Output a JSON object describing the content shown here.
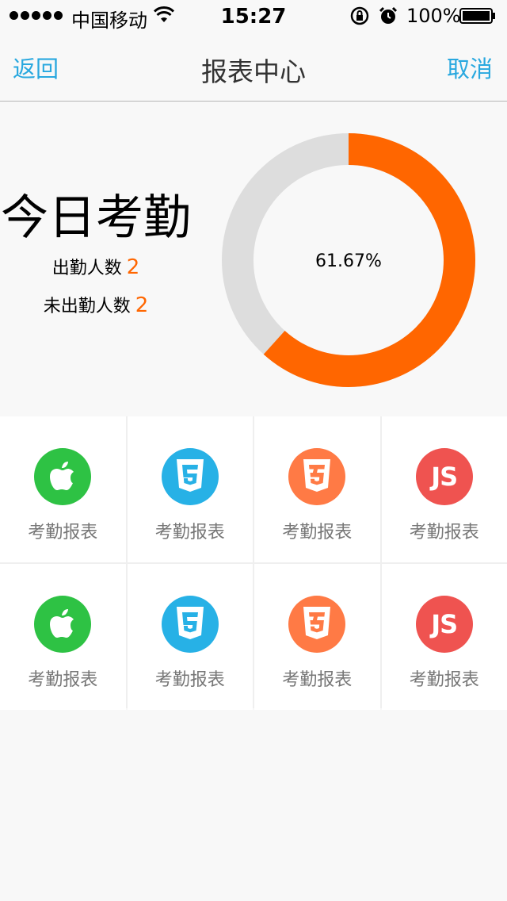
{
  "status_bar": {
    "carrier": "中国移动",
    "time": "15:27",
    "battery": "100%"
  },
  "nav": {
    "back": "返回",
    "title": "报表中心",
    "cancel": "取消"
  },
  "summary": {
    "title": "今日考勤",
    "attended_label": "出勤人数",
    "attended_value": "2",
    "absent_label": "未出勤人数",
    "absent_value": "2",
    "percent_text": "61.67%",
    "percent_value": 61.67
  },
  "colors": {
    "accent": "#ff6600",
    "nav_link": "#29a8df",
    "donut_track": "#dddddd"
  },
  "grid": {
    "items": [
      {
        "icon": "apple-icon",
        "color": "#2ec244",
        "label": "考勤报表"
      },
      {
        "icon": "html5-icon",
        "color": "#27b1e6",
        "label": "考勤报表"
      },
      {
        "icon": "css3-icon",
        "color": "#ff7a45",
        "label": "考勤报表"
      },
      {
        "icon": "js-icon",
        "color": "#ef5350",
        "label": "考勤报表",
        "glyph": "JS"
      },
      {
        "icon": "apple-icon",
        "color": "#2ec244",
        "label": "考勤报表"
      },
      {
        "icon": "html5-icon",
        "color": "#27b1e6",
        "label": "考勤报表"
      },
      {
        "icon": "css3-icon",
        "color": "#ff7a45",
        "label": "考勤报表"
      },
      {
        "icon": "js-icon",
        "color": "#ef5350",
        "label": "考勤报表",
        "glyph": "JS"
      }
    ]
  }
}
